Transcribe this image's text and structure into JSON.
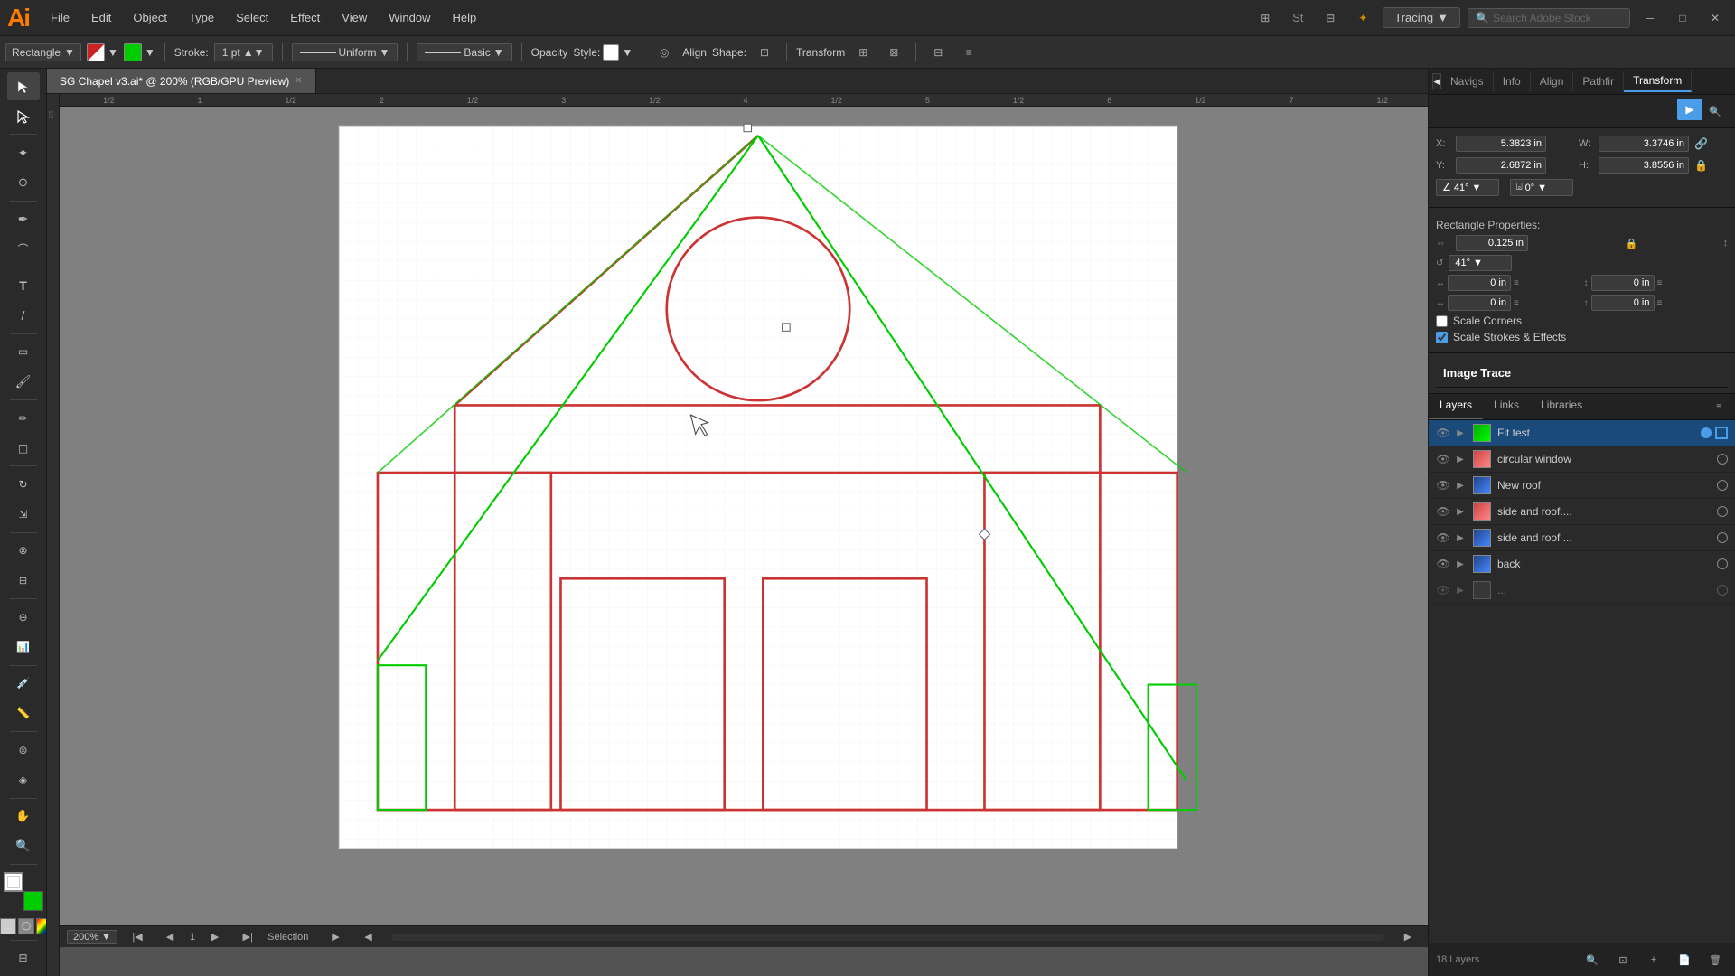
{
  "app": {
    "logo": "Ai",
    "title": "SG Chapel v3.ai* @ 200% (RGB/GPU Preview)"
  },
  "menu": {
    "items": [
      "File",
      "Edit",
      "Object",
      "Type",
      "Select",
      "Effect",
      "View",
      "Window",
      "Help"
    ]
  },
  "toolbar": {
    "tool_name": "Rectangle",
    "stroke_label": "Stroke:",
    "stroke_value": "1 pt",
    "uniform_label": "Uniform",
    "basic_label": "Basic",
    "opacity_label": "Opacity",
    "style_label": "Style:",
    "align_label": "Align",
    "shape_label": "Shape:",
    "transform_label": "Transform"
  },
  "workspace": {
    "name": "Tracing",
    "dropdown_arrow": "▼"
  },
  "search": {
    "placeholder": "Search Adobe Stock"
  },
  "status_bar": {
    "zoom": "200%",
    "page": "1",
    "selection": "Selection"
  },
  "transform_panel": {
    "title": "Transform",
    "x_label": "X:",
    "x_value": "5.3823 in",
    "y_label": "Y:",
    "y_value": "2.6872 in",
    "w_label": "W:",
    "w_value": "3.3746 in",
    "h_label": "H:",
    "h_value": "3.8556 in",
    "angle_label": "∠",
    "angle_value": "41°",
    "shear_label": "⌻",
    "shear_value": "0°",
    "rect_props_title": "Rectangle Properties:",
    "rect_w_value": "0.125 in",
    "rect_x_value": "0 in",
    "rect_y_value": "0 in",
    "rect_x2_value": "0 in",
    "rect_y2_value": "0 in",
    "rect_angle_value": "41°",
    "scale_corners_label": "Scale Corners",
    "scale_strokes_label": "Scale Strokes & Effects"
  },
  "image_trace": {
    "title": "Image Trace"
  },
  "layers": {
    "tabs": [
      "Layers",
      "Links",
      "Libraries"
    ],
    "items": [
      {
        "name": "Fit test",
        "active": true,
        "visible": true,
        "expanded": true,
        "thumb": "green"
      },
      {
        "name": "circular window",
        "active": false,
        "visible": true,
        "expanded": false,
        "thumb": "pink"
      },
      {
        "name": "New roof",
        "active": false,
        "visible": true,
        "expanded": false,
        "thumb": "blue"
      },
      {
        "name": "side and roof....",
        "active": false,
        "visible": true,
        "expanded": false,
        "thumb": "pink"
      },
      {
        "name": "side and roof ...",
        "active": false,
        "visible": true,
        "expanded": false,
        "thumb": "blue"
      },
      {
        "name": "back",
        "active": false,
        "visible": true,
        "expanded": false,
        "thumb": "blue"
      }
    ],
    "total_layers": "18 Layers"
  },
  "panel_tabs": [
    "Navigs",
    "Info",
    "Align",
    "Pathfir",
    "Transform"
  ],
  "canvas": {
    "zoom_level": "200%"
  }
}
